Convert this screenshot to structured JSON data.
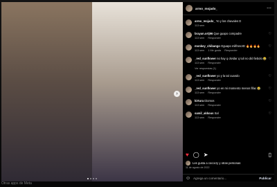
{
  "page": {
    "bottom_label": "Otras apps de Meta"
  },
  "media": {
    "dots": 4,
    "active_dot": 1,
    "next_icon": "chevron-right-icon"
  },
  "header": {
    "username": "armo_mojado_"
  },
  "comments": [
    {
      "user": "armo_mojado_",
      "text": "Yo y los chavales D",
      "time": "113 sem",
      "reply": "",
      "likes": "",
      "replies": ""
    },
    {
      "user": "brayan.ortj96",
      "text": "Que guapo compadre",
      "time": "113 sem",
      "likes": "",
      "reply": "Responder",
      "replies": ""
    },
    {
      "user": "monkey_chibango",
      "text": "Oguapo milfroso!D 🔥🔥🔥🔥",
      "time": "113 sem",
      "likes": "1 Me gusta",
      "reply": "Responder",
      "replies": ""
    },
    {
      "user": "_red_sunflower",
      "text": "no hay q olvidar q tuli no dió fiebolo 😂",
      "time": "113 sem",
      "likes": "",
      "reply": "Responder",
      "replies": "Ver respuestas (1)"
    },
    {
      "user": "_red_sunflower",
      "text": "yo y la tal cuando",
      "time": "113 sem",
      "likes": "",
      "reply": "Responder",
      "replies": ""
    },
    {
      "user": "_red_sunflower",
      "text": "yo en mi momento menos fifac 😂",
      "time": "113 sem",
      "likes": "",
      "reply": "Responder",
      "replies": ""
    },
    {
      "user": "kirtura",
      "text": "Diomos",
      "time": "113 sem",
      "likes": "",
      "reply": "Responder",
      "replies": ""
    },
    {
      "user": "samil_akkous",
      "text": "Sal",
      "time": "113 sem",
      "likes": "",
      "reply": "Responder",
      "replies": ""
    }
  ],
  "actions": {
    "like_icon": "heart-icon",
    "comment_icon": "comment-icon",
    "share_icon": "send-icon",
    "save_icon": "bookmark-icon"
  },
  "likes_text": "Les gusta a cococry y otras personas",
  "date": "11 de agosto de 2022",
  "add_comment": {
    "placeholder": "Agrega un comentario...",
    "post_label": "Publicar"
  },
  "colors": {
    "background": "#000000",
    "like": "#ff3040",
    "muted": "#a8a8a8"
  }
}
